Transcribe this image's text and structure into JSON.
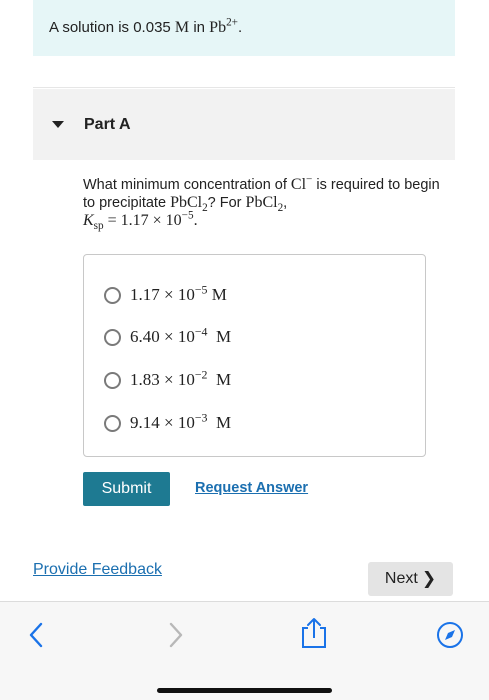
{
  "banner": {
    "prefix": "A solution is 0.035 ",
    "unit": "M",
    "in_text": " in ",
    "ion_base": "Pb",
    "ion_charge": "2+",
    "end": "."
  },
  "part": {
    "title": "Part A"
  },
  "question": {
    "t1": "What minimum concentration of ",
    "cl": "Cl",
    "cl_charge": "−",
    "t2": " is required to begin to precipitate ",
    "pbcl2_a": "PbCl",
    "pbcl2_a_sub": "2",
    "t3": "? For ",
    "pbcl2_b": "PbCl",
    "pbcl2_b_sub": "2",
    "t4": ",",
    "ksp_k": "K",
    "ksp_sub": "sp",
    "ksp_value": " = 1.17 × 10",
    "ksp_exp": "−5",
    "end": "."
  },
  "choices": [
    {
      "mantissa": "1.17 × 10",
      "exp": "−5",
      "unit": " M"
    },
    {
      "mantissa": "6.40 × 10",
      "exp": "−4",
      "unit": "  M"
    },
    {
      "mantissa": "1.83 × 10",
      "exp": "−2",
      "unit": "  M"
    },
    {
      "mantissa": "9.14 × 10",
      "exp": "−3",
      "unit": "  M"
    }
  ],
  "actions": {
    "submit_label": "Submit",
    "request_answer_label": "Request Answer"
  },
  "footer": {
    "feedback_label": "Provide Feedback",
    "next_label": "Next"
  },
  "browser": {
    "icons": [
      "back-chevron-icon",
      "forward-chevron-icon",
      "share-icon",
      "compass-icon"
    ],
    "accent": "#1a73e8"
  }
}
